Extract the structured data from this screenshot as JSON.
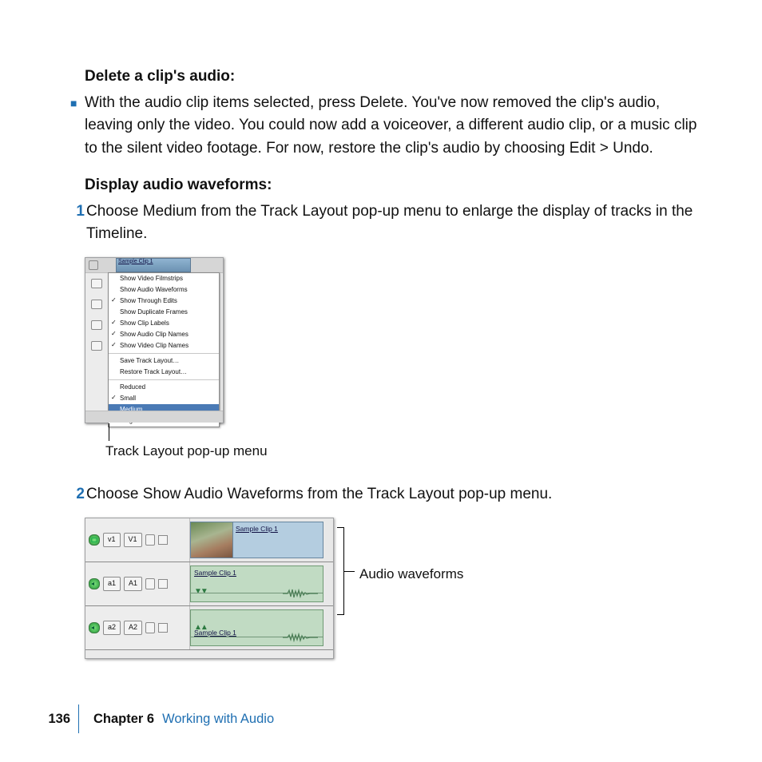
{
  "section1": {
    "heading": "Delete a clip's audio:",
    "bullet_text": "With the audio clip items selected, press Delete. You've now removed the clip's audio, leaving only the video. You could now add a voiceover, a different audio clip, or a music clip to the silent video footage. For now, restore the clip's audio by choosing Edit > Undo."
  },
  "section2": {
    "heading": "Display audio waveforms:",
    "step1_num": "1",
    "step1": "Choose Medium from the Track Layout pop-up menu to enlarge the display of tracks in the Timeline.",
    "step2_num": "2",
    "step2": "Choose Show Audio Waveforms from the Track Layout pop-up menu."
  },
  "popup_menu": {
    "clip_name": "Sample Clip 1",
    "items": [
      "Show Video Filmstrips",
      "Show Audio Waveforms",
      "Show Through Edits",
      "Show Duplicate Frames",
      "Show Clip Labels",
      "Show Audio Clip Names",
      "Show Video Clip Names",
      "Save Track Layout…",
      "Restore Track Layout…",
      "Reduced",
      "Small",
      "Medium",
      "Large"
    ]
  },
  "tracks": {
    "v1_src": "v1",
    "v1_dst": "V1",
    "a1_src": "a1",
    "a1_dst": "A1",
    "a2_src": "a2",
    "a2_dst": "A2",
    "clip_name_v": "Sample Clip 1",
    "clip_name_a1": "Sample Clip 1",
    "clip_name_a2": "Sample Clip 1"
  },
  "callouts": {
    "track_layout": "Track Layout pop-up menu",
    "waveforms": "Audio waveforms"
  },
  "footer": {
    "page": "136",
    "chapter": "Chapter 6",
    "title": "Working with Audio"
  }
}
